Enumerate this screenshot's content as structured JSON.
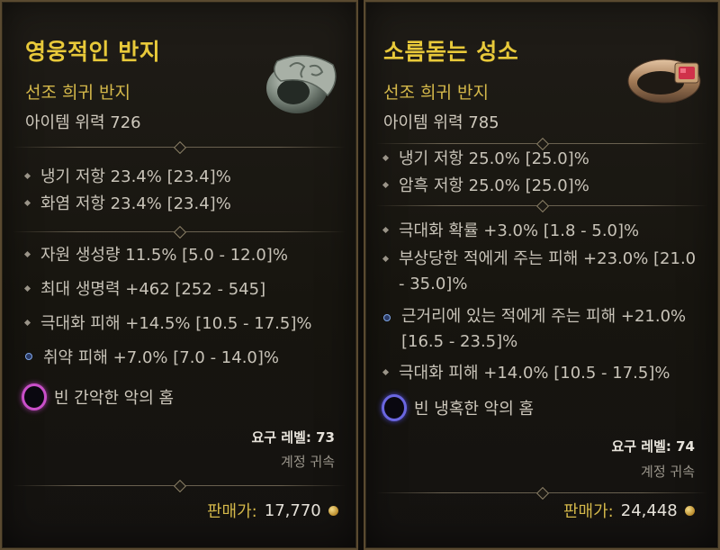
{
  "items": [
    {
      "name": "영웅적인 반지",
      "rarity_type": "선조 희귀 반지",
      "item_power": "아이템 위력 726",
      "implicit_stats": [
        "냉기 저항 23.4% [23.4]%",
        "화염 저항 23.4% [23.4]%"
      ],
      "affixes": [
        {
          "text": "자원 생성량 11.5% [5.0 - 12.0]%",
          "bullet": "diamond"
        },
        {
          "text": "최대 생명력 +462 [252 - 545]",
          "bullet": "diamond"
        },
        {
          "text": "극대화 피해 +14.5% [10.5 - 17.5]%",
          "bullet": "diamond"
        },
        {
          "text": "취약 피해 +7.0% [7.0 - 14.0]%",
          "bullet": "blue-circle"
        }
      ],
      "socket": {
        "label": "빈 간악한 악의 홈",
        "color": "#c94fc9"
      },
      "requirement": "요구 레벨: 73",
      "binding": "계정 귀속",
      "price_label": "판매가:",
      "price_value": "17,770",
      "ring_icon": "stone-ring-icon"
    },
    {
      "name": "소름돋는 성소",
      "rarity_type": "선조 희귀 반지",
      "item_power": "아이템 위력 785",
      "implicit_stats": [
        "냉기 저항 25.0% [25.0]%",
        "암흑 저항 25.0% [25.0]%"
      ],
      "affixes": [
        {
          "text": "극대화 확률 +3.0% [1.8 - 5.0]%",
          "bullet": "diamond"
        },
        {
          "text": "부상당한 적에게 주는 피해 +23.0% [21.0 - 35.0]%",
          "bullet": "diamond"
        },
        {
          "text": "근거리에 있는 적에게 주는 피해 +21.0% [16.5 - 23.5]%",
          "bullet": "blue-circle"
        },
        {
          "text": "극대화 피해 +14.0% [10.5 - 17.5]%",
          "bullet": "diamond"
        }
      ],
      "socket": {
        "label": "빈 냉혹한 악의 홈",
        "color": "#6a66e0"
      },
      "requirement": "요구 레벨: 74",
      "binding": "계정 귀속",
      "price_label": "판매가:",
      "price_value": "24,448",
      "ring_icon": "ruby-band-ring-icon"
    }
  ]
}
